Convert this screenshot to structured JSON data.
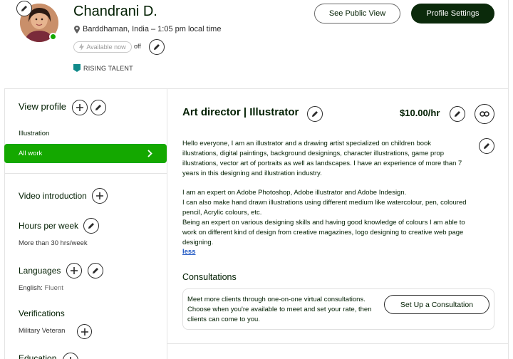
{
  "profile": {
    "name": "Chandrani D.",
    "location": "Barddhaman, India – 1:05 pm local time",
    "availability_label": "Available now",
    "availability_state": "off",
    "badge": "RISING TALENT"
  },
  "header": {
    "public_view_label": "See Public View",
    "settings_label": "Profile Settings"
  },
  "left": {
    "view_profile": "View profile",
    "category": "Illustration",
    "all_work": "All work",
    "video_intro": "Video introduction",
    "hours_heading": "Hours per week",
    "hours_value": "More than 30 hrs/week",
    "languages_heading": "Languages",
    "language_name": "English:",
    "language_level": "Fluent",
    "verifications_heading": "Verifications",
    "verification_item": "Military Veteran",
    "education_heading": "Education"
  },
  "main": {
    "title": "Art director | Illustrator",
    "rate": "$10.00/hr",
    "desc_p1": "Hello everyone, I am an illustrator and a drawing artist specialized on children book illustrations, digital paintings, background designings, character illustrations, game prop illustrations, vector art of portraits as well as landscapes. I have an experience of more than 7 years in this designing and illustration industry.",
    "desc_p2": "I am an expert on Adobe Photoshop, Adobe illustrator and Adobe Indesign.",
    "desc_p3": "I can also make hand drawn illustrations using different medium like watercolour, pen, coloured pencil, Acrylic colours, etc.",
    "desc_p4": "Being an expert on various designing skills and having good knowledge of colours I am able to work on different kind of design from creative magazines, logo designing to creative web page designing.",
    "less_label": "less",
    "consult_heading": "Consultations",
    "consult_text": "Meet more clients through one-on-one virtual consultations. Choose when you're available to meet and set your rate, then clients can come to you.",
    "consult_button": "Set Up a Consultation"
  },
  "colors": {
    "brand_green": "#14a800",
    "dark_button": "#0b2a0b",
    "link_blue": "#1f57c3",
    "badge_teal": "#108a8a"
  },
  "icons": [
    "pencil-icon",
    "plus-icon",
    "link-icon",
    "location-pin-icon",
    "bolt-icon",
    "chevron-right-icon",
    "shield-badge-icon"
  ]
}
